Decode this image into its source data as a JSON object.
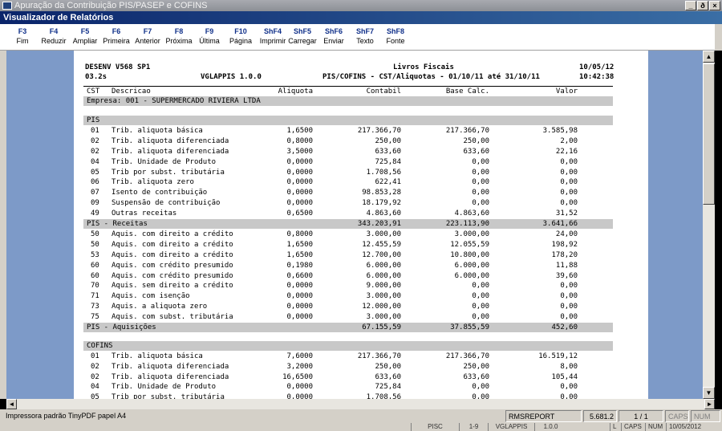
{
  "window": {
    "outer_title": "Apuração da Contribuição PIS/PASEP e COFINS",
    "inner_title": "Visualizador de Relatórios",
    "controls": [
      "_",
      "ð",
      "×"
    ]
  },
  "fkeys": [
    {
      "key": "F3",
      "label": "Fim"
    },
    {
      "key": "F4",
      "label": "Reduzir"
    },
    {
      "key": "F5",
      "label": "Ampliar"
    },
    {
      "key": "F6",
      "label": "Primeira"
    },
    {
      "key": "F7",
      "label": "Anterior"
    },
    {
      "key": "F8",
      "label": "Próxima"
    },
    {
      "key": "F9",
      "label": "Última"
    },
    {
      "key": "F10",
      "label": "Página"
    },
    {
      "key": "ShF4",
      "label": "Imprimir"
    },
    {
      "key": "ShF5",
      "label": "Carregar"
    },
    {
      "key": "ShF6",
      "label": "Enviar"
    },
    {
      "key": "ShF7",
      "label": "Texto"
    },
    {
      "key": "ShF8",
      "label": "Fonte"
    }
  ],
  "report": {
    "system": "DESENV V568 SP1",
    "version": "03.2s",
    "program": "VGLAPPIS 1.0.0",
    "title1": "Livros Fiscais",
    "title2": "PIS/COFINS - CST/Aliquotas - 01/10/11 até 31/10/11",
    "date": "10/05/12",
    "time": "10:42:38",
    "columns": [
      "CST",
      "Descricao",
      "Aliquota",
      "Contabil",
      "Base Calc.",
      "Valor"
    ],
    "empresa": "Empresa: 001 - SUPERMERCADO RIVIERA LTDA",
    "sections": [
      {
        "label": "PIS",
        "rows": [
          [
            "01",
            "Trib. aliquota básica",
            "1,6500",
            "217.366,70",
            "217.366,70",
            "3.585,98"
          ],
          [
            "02",
            "Trib. aliquota diferenciada",
            "0,8000",
            "250,00",
            "250,00",
            "2,00"
          ],
          [
            "02",
            "Trib. aliquota diferenciada",
            "3,5000",
            "633,60",
            "633,60",
            "22,16"
          ],
          [
            "04",
            "Trib. Unidade de Produto",
            "0,0000",
            "725,84",
            "0,00",
            "0,00"
          ],
          [
            "05",
            "Trib por subst. tributária",
            "0,0000",
            "1.708,56",
            "0,00",
            "0,00"
          ],
          [
            "06",
            "Trib. aliquota zero",
            "0,0000",
            "622,41",
            "0,00",
            "0,00"
          ],
          [
            "07",
            "Isento de contribuição",
            "0,0000",
            "98.853,28",
            "0,00",
            "0,00"
          ],
          [
            "09",
            "Suspensão de contribuição",
            "0,0000",
            "18.179,92",
            "0,00",
            "0,00"
          ],
          [
            "49",
            "Outras receitas",
            "0,6500",
            "4.863,60",
            "4.863,60",
            "31,52"
          ]
        ],
        "total": {
          "label": "PIS - Receitas",
          "contabil": "343.203,91",
          "base": "223.113,90",
          "valor": "3.641,66"
        }
      },
      {
        "label": "",
        "rows": [
          [
            "50",
            "Aquis. com direito a crédito",
            "0,8000",
            "3.000,00",
            "3.000,00",
            "24,00"
          ],
          [
            "50",
            "Aquis. com direito a crédito",
            "1,6500",
            "12.455,59",
            "12.055,59",
            "198,92"
          ],
          [
            "53",
            "Aquis. com direito a crédito",
            "1,6500",
            "12.700,00",
            "10.800,00",
            "178,20"
          ],
          [
            "60",
            "Aquis. com crédito presumido",
            "0,1980",
            "6.000,00",
            "6.000,00",
            "11,88"
          ],
          [
            "60",
            "Aquis. com crédito presumido",
            "0,6600",
            "6.000,00",
            "6.000,00",
            "39,60"
          ],
          [
            "70",
            "Aquis. sem direito a crédito",
            "0,0000",
            "9.000,00",
            "0,00",
            "0,00"
          ],
          [
            "71",
            "Aquis. com isenção",
            "0,0000",
            "3.000,00",
            "0,00",
            "0,00"
          ],
          [
            "73",
            "Aquis. a aliquota zero",
            "0,0000",
            "12.000,00",
            "0,00",
            "0,00"
          ],
          [
            "75",
            "Aquis. com subst. tributária",
            "0,0000",
            "3.000,00",
            "0,00",
            "0,00"
          ]
        ],
        "total": {
          "label": "PIS - Aquisições",
          "contabil": "67.155,59",
          "base": "37.855,59",
          "valor": "452,60"
        }
      },
      {
        "label": "COFINS",
        "rows": [
          [
            "01",
            "Trib. aliquota básica",
            "7,6000",
            "217.366,70",
            "217.366,70",
            "16.519,12"
          ],
          [
            "02",
            "Trib. aliquota diferenciada",
            "3,2000",
            "250,00",
            "250,00",
            "8,00"
          ],
          [
            "02",
            "Trib. aliquota diferenciada",
            "16,6500",
            "633,60",
            "633,60",
            "105,44"
          ],
          [
            "04",
            "Trib. Unidade de Produto",
            "0,0000",
            "725,84",
            "0,00",
            "0,00"
          ],
          [
            "05",
            "Trib por subst. tributária",
            "0,0000",
            "1.708,56",
            "0,00",
            "0,00"
          ]
        ]
      }
    ]
  },
  "status": {
    "printer": "Impressora padrão TinyPDF papel A4",
    "module": "RMSREPORT",
    "version": "5.681.2",
    "page": "1 / 1",
    "caps": "CAPS",
    "num": "NUM"
  },
  "taskbar": {
    "items": [
      "PISC",
      "1-9",
      "VGLAPPIS",
      "1.0.0",
      "L",
      "CAPS",
      "NUM",
      "10/05/2012"
    ]
  }
}
